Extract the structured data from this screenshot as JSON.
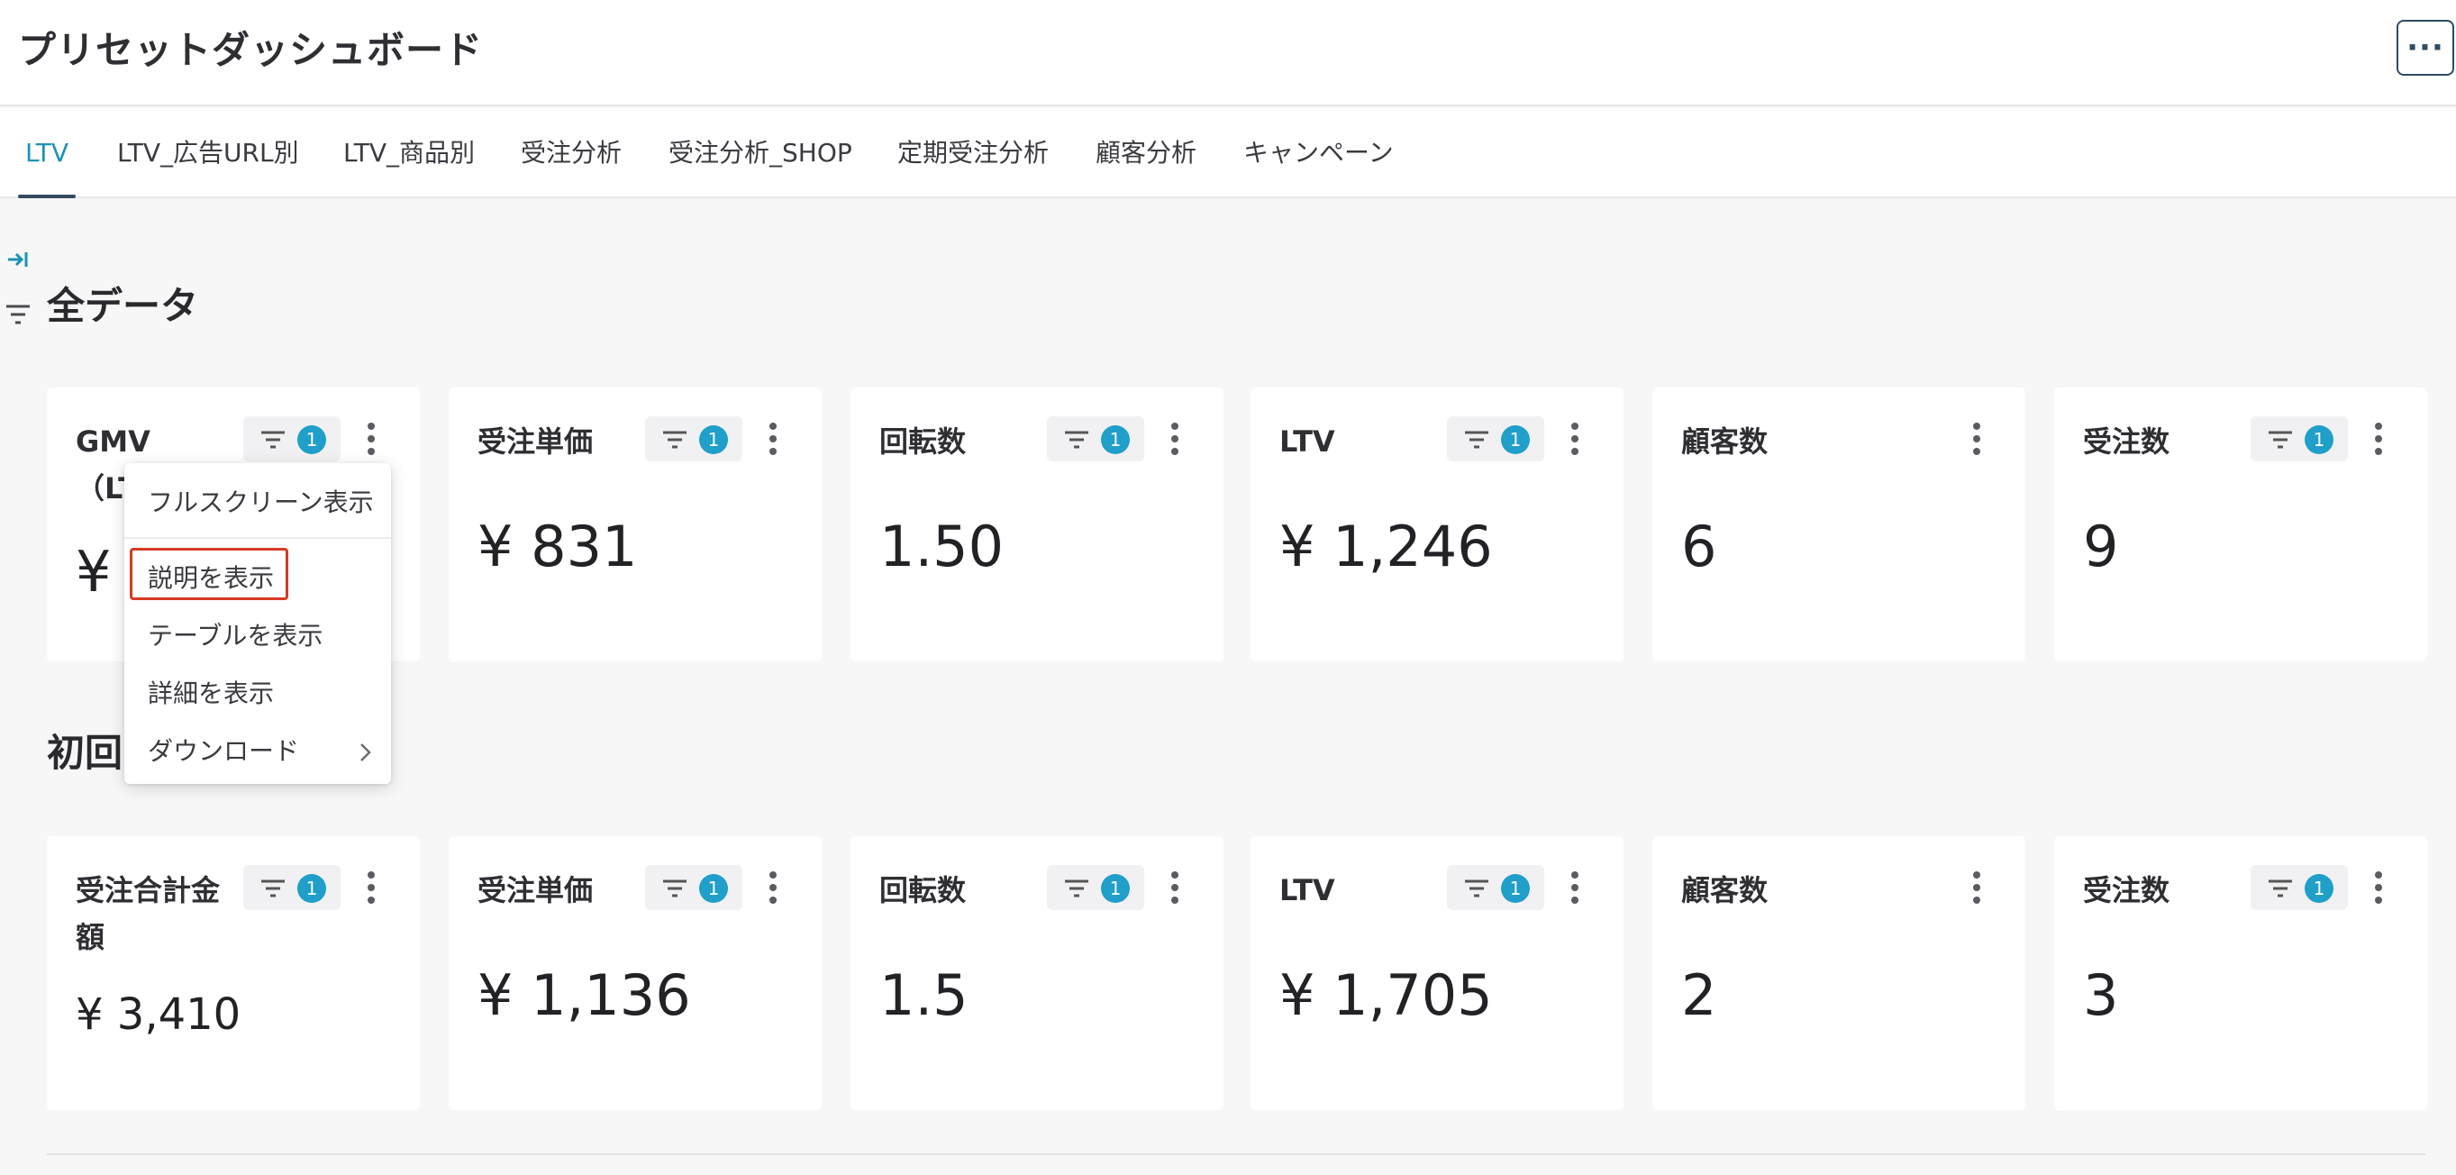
{
  "header": {
    "title": "プリセットダッシュボード",
    "more_label": "···"
  },
  "tabs": [
    {
      "label": "LTV",
      "active": true
    },
    {
      "label": "LTV_広告URL別",
      "active": false
    },
    {
      "label": "LTV_商品別",
      "active": false
    },
    {
      "label": "受注分析",
      "active": false
    },
    {
      "label": "受注分析_SHOP",
      "active": false
    },
    {
      "label": "定期受注分析",
      "active": false
    },
    {
      "label": "顧客分析",
      "active": false
    },
    {
      "label": "キャンペーン",
      "active": false
    }
  ],
  "sections": [
    {
      "title": "全データ",
      "cards": [
        {
          "title": "GMV（LTV計測",
          "value": "¥ 7",
          "filter_count": "1",
          "has_filter": true
        },
        {
          "title": "受注単価",
          "value": "¥ 831",
          "filter_count": "1",
          "has_filter": true
        },
        {
          "title": "回転数",
          "value": "1.50",
          "filter_count": "1",
          "has_filter": true
        },
        {
          "title": "LTV",
          "value": "¥ 1,246",
          "filter_count": "1",
          "has_filter": true
        },
        {
          "title": "顧客数",
          "value": "6",
          "filter_count": "",
          "has_filter": false
        },
        {
          "title": "受注数",
          "value": "9",
          "filter_count": "1",
          "has_filter": true
        }
      ]
    },
    {
      "title": "初回",
      "cards": [
        {
          "title": "受注合計金額",
          "value": "¥ 3,410",
          "filter_count": "1",
          "has_filter": true
        },
        {
          "title": "受注単価",
          "value": "¥ 1,136",
          "filter_count": "1",
          "has_filter": true
        },
        {
          "title": "回転数",
          "value": "1.5",
          "filter_count": "1",
          "has_filter": true
        },
        {
          "title": "LTV",
          "value": "¥ 1,705",
          "filter_count": "1",
          "has_filter": true
        },
        {
          "title": "顧客数",
          "value": "2",
          "filter_count": "",
          "has_filter": false
        },
        {
          "title": "受注数",
          "value": "3",
          "filter_count": "1",
          "has_filter": true
        }
      ]
    }
  ],
  "context_menu": {
    "items": [
      {
        "label": "フルスクリーン表示"
      },
      {
        "label": "説明を表示",
        "highlighted": true
      },
      {
        "label": "テーブルを表示"
      },
      {
        "label": "詳細を表示"
      },
      {
        "label": "ダウンロード",
        "has_submenu": true
      }
    ]
  },
  "colors": {
    "accent": "#1c93b3",
    "badge": "#1f9fc9",
    "highlight_border": "#d63a25",
    "background": "#f7f7f8"
  }
}
